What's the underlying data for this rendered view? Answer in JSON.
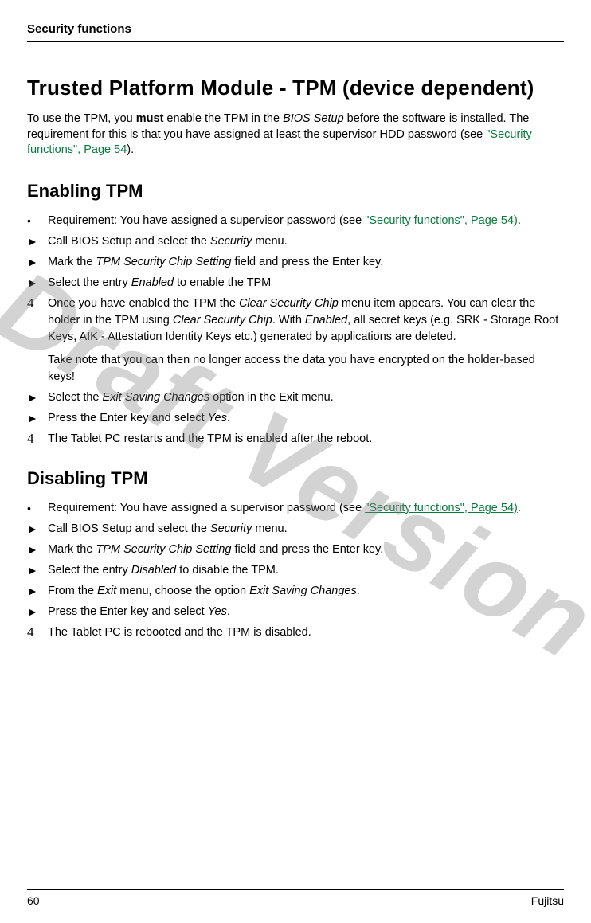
{
  "header": {
    "section_title": "Security functions"
  },
  "title": "Trusted Platform Module - TPM (device dependent)",
  "intro": {
    "pre": "To use the TPM, you ",
    "must": "must",
    "mid": " enable the TPM in the ",
    "bios": "BIOS Setup",
    "post1": " before the software is installed. The requirement for this is that you have assigned at least the supervisor HDD password (see ",
    "link": "\"Security functions\", Page 54",
    "post2": ")."
  },
  "enabling": {
    "heading": "Enabling TPM",
    "items": {
      "req_pre": "Requirement: You have assigned a supervisor password (see ",
      "req_link": "\"Security functions\", Page 54)",
      "req_post": ".",
      "call_pre": "Call BIOS Setup and select the ",
      "call_menu": "Security",
      "call_post": " menu.",
      "mark_pre": "Mark the ",
      "mark_field": "TPM Security Chip Setting",
      "mark_post": " field and press the Enter key.",
      "select_pre": "Select the entry ",
      "select_val": "Enabled",
      "select_post": " to enable the TPM",
      "note1_pre": "Once you have enabled the TPM the ",
      "note1_clear": "Clear Security Chip",
      "note1_mid": " menu item appears. You can clear the holder in the TPM using ",
      "note1_clear2": "Clear Security Chip",
      "note1_mid2": ". With ",
      "note1_enabled": "Enabled",
      "note1_post": ", all secret keys (e.g. SRK - Storage Root Keys, AIK - Attestation Identity Keys etc.) generated by applications are deleted.",
      "note2": "Take note that you can then no longer access the data you have encrypted on the holder-based keys!",
      "exit_pre": "Select the ",
      "exit_opt": "Exit Saving Changes",
      "exit_post": " option in the Exit menu.",
      "press_pre": "Press the Enter key and select ",
      "press_yes": "Yes",
      "press_post": ".",
      "restart": "The Tablet PC restarts and the TPM is enabled after the reboot."
    }
  },
  "disabling": {
    "heading": "Disabling TPM",
    "items": {
      "req_pre": "Requirement: You have assigned a supervisor password (see ",
      "req_link": "\"Security functions\", Page 54)",
      "req_post": ".",
      "call_pre": "Call BIOS Setup and select the ",
      "call_menu": "Security",
      "call_post": " menu.",
      "mark_pre": "Mark the ",
      "mark_field": "TPM Security Chip Setting",
      "mark_post": " field and press the Enter key.",
      "select_pre": "Select the entry ",
      "select_val": "Disabled",
      "select_post": " to disable the TPM.",
      "from_pre": "From the ",
      "from_exit": "Exit",
      "from_mid": " menu, choose the option ",
      "from_opt": "Exit Saving Changes",
      "from_post": ".",
      "press_pre": "Press the Enter key and select ",
      "press_yes": "Yes",
      "press_post": ".",
      "reboot": "The Tablet PC is rebooted and the TPM is disabled."
    }
  },
  "footer": {
    "page": "60",
    "brand": "Fujitsu"
  },
  "watermark": "Draft Version"
}
